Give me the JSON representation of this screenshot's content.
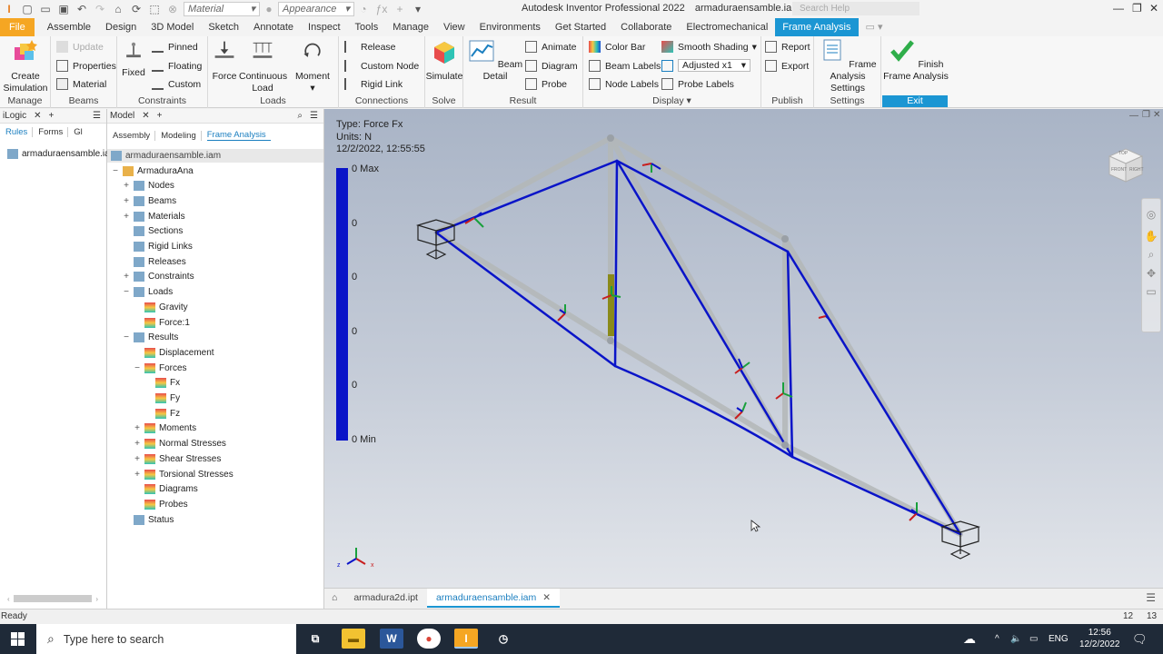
{
  "quick_access": {
    "material_combo": "Material",
    "appearance_combo": "Appearance"
  },
  "app": {
    "title": "Autodesk Inventor Professional 2022",
    "document": "armaduraensamble.iam",
    "search_placeholder": "Search Help"
  },
  "tabs": [
    "File",
    "Assemble",
    "Design",
    "3D Model",
    "Sketch",
    "Annotate",
    "Inspect",
    "Tools",
    "Manage",
    "View",
    "Environments",
    "Get Started",
    "Collaborate",
    "Electromechanical",
    "Frame Analysis"
  ],
  "ribbon": {
    "manage": {
      "label": "Manage",
      "create_simulation": "Create\nSimulation"
    },
    "beams": {
      "label": "Beams",
      "update": "Update",
      "properties": "Properties",
      "material": "Material"
    },
    "constraints": {
      "label": "Constraints",
      "fixed": "Fixed",
      "pinned": "Pinned",
      "floating": "Floating",
      "custom": "Custom"
    },
    "loads": {
      "label": "Loads",
      "force": "Force",
      "continuous_load": "Continuous\nLoad",
      "moment": "Moment"
    },
    "connections": {
      "label": "Connections",
      "release": "Release",
      "custom_node": "Custom Node",
      "rigid_link": "Rigid Link"
    },
    "solve": {
      "label": "Solve",
      "simulate": "Simulate"
    },
    "result": {
      "label": "Result",
      "beam_detail": "Beam Detail",
      "animate": "Animate",
      "diagram": "Diagram",
      "probe": "Probe"
    },
    "display": {
      "label": "Display",
      "color_bar": "Color Bar",
      "beam_labels": "Beam Labels",
      "node_labels": "Node Labels",
      "smooth_shading": "Smooth Shading",
      "adjusted": "Adjusted x1",
      "probe_labels": "Probe Labels"
    },
    "publish": {
      "label": "Publish",
      "report": "Report",
      "export": "Export"
    },
    "settings": {
      "label": "Settings",
      "frame_analysis_settings": "Frame Analysis\nSettings"
    },
    "exit": {
      "label": "Exit",
      "finish": "Finish\nFrame Analysis"
    }
  },
  "ilogic_panel": {
    "title": "iLogic",
    "subtabs": [
      "Rules",
      "Forms",
      "Gl"
    ],
    "item": "armaduraensamble.iam"
  },
  "model_panel": {
    "title": "Model",
    "subtabs": [
      "Assembly",
      "Modeling",
      "Frame Analysis"
    ],
    "root": "armaduraensamble.iam",
    "tree": [
      {
        "label": "ArmaduraAna",
        "exp": "−",
        "level": 0
      },
      {
        "label": "Nodes",
        "exp": "+",
        "level": 1
      },
      {
        "label": "Beams",
        "exp": "+",
        "level": 1
      },
      {
        "label": "Materials",
        "exp": "+",
        "level": 1
      },
      {
        "label": "Sections",
        "exp": "",
        "level": 1
      },
      {
        "label": "Rigid Links",
        "exp": "",
        "level": 1
      },
      {
        "label": "Releases",
        "exp": "",
        "level": 1
      },
      {
        "label": "Constraints",
        "exp": "+",
        "level": 1
      },
      {
        "label": "Loads",
        "exp": "−",
        "level": 1
      },
      {
        "label": "Gravity",
        "exp": "",
        "level": 2
      },
      {
        "label": "Force:1",
        "exp": "",
        "level": 2
      },
      {
        "label": "Results",
        "exp": "−",
        "level": 1
      },
      {
        "label": "Displacement",
        "exp": "",
        "level": 2
      },
      {
        "label": "Forces",
        "exp": "−",
        "level": 2
      },
      {
        "label": "Fx",
        "exp": "",
        "level": 3
      },
      {
        "label": "Fy",
        "exp": "",
        "level": 3
      },
      {
        "label": "Fz",
        "exp": "",
        "level": 3
      },
      {
        "label": "Moments",
        "exp": "+",
        "level": 2
      },
      {
        "label": "Normal Stresses",
        "exp": "+",
        "level": 2
      },
      {
        "label": "Shear Stresses",
        "exp": "+",
        "level": 2
      },
      {
        "label": "Torsional Stresses",
        "exp": "+",
        "level": 2
      },
      {
        "label": "Diagrams",
        "exp": "",
        "level": 2
      },
      {
        "label": "Probes",
        "exp": "",
        "level": 2
      },
      {
        "label": "Status",
        "exp": "",
        "level": 1
      }
    ]
  },
  "viewport": {
    "type_line": "Type: Force Fx",
    "units_line": "Units: N",
    "date_line": "12/2/2022, 12:55:55",
    "scale_labels": [
      "0 Max",
      "0",
      "0",
      "0",
      "0",
      "0 Min"
    ],
    "viewcube": [
      "TOP",
      "FRONT",
      "RIGHT"
    ]
  },
  "doc_tabs": [
    "armadura2d.ipt",
    "armaduraensamble.iam"
  ],
  "status": {
    "text": "Ready",
    "num1": "12",
    "num2": "13"
  },
  "taskbar": {
    "search": "Type here to search",
    "lang": "ENG",
    "time": "12:56",
    "date": "12/2/2022"
  },
  "colors": {
    "accent": "#1b96d3",
    "file_tab": "#f5a623",
    "frame_blue": "#0a14c8"
  }
}
